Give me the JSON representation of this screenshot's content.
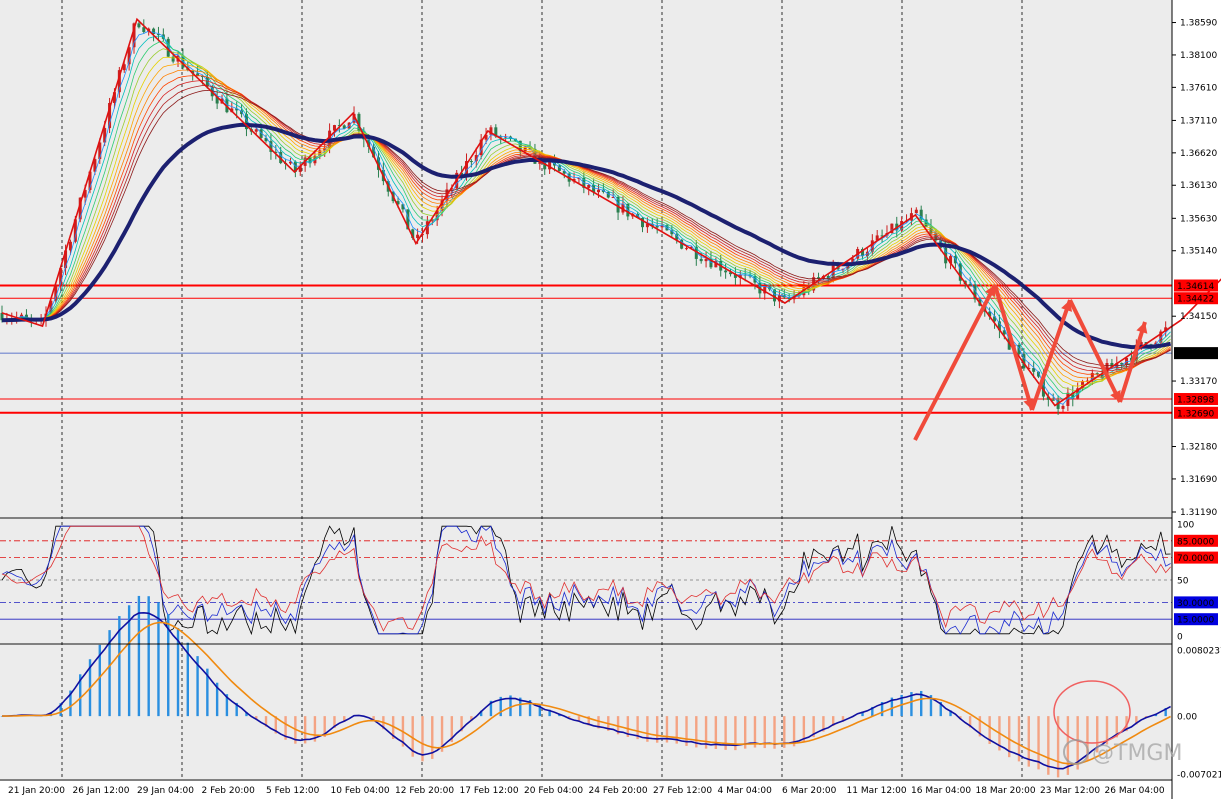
{
  "chart_data": {
    "type": "candlestick",
    "main_price_labels": [
      "1.38590",
      "1.38100",
      "1.37610",
      "1.37110",
      "1.36620",
      "1.36130",
      "1.35630",
      "1.35140",
      "1.34150",
      "1.33170",
      "1.32180",
      "1.31690",
      "1.31190"
    ],
    "price_range": [
      1.3119,
      1.3884
    ],
    "current_price": "1.33592",
    "horizontal_levels": [
      {
        "label": "1.34614",
        "value": 1.34614,
        "color": "#ff0000",
        "width": 2
      },
      {
        "label": "1.34422",
        "value": 1.34422,
        "color": "#ff0000",
        "width": 1
      },
      {
        "label": "1.32898",
        "value": 1.32898,
        "color": "#ff0000",
        "width": 1
      },
      {
        "label": "1.32690",
        "value": 1.3269,
        "color": "#ff0000",
        "width": 2
      }
    ],
    "time_labels": [
      "21 Jan 20:00",
      "26 Jan 12:00",
      "29 Jan 04:00",
      "2 Feb 20:00",
      "5 Feb 12:00",
      "10 Feb 04:00",
      "12 Feb 20:00",
      "17 Feb 12:00",
      "20 Feb 04:00",
      "24 Feb 20:00",
      "27 Feb 12:00",
      "4 Mar 04:00",
      "6 Mar 20:00",
      "11 Mar 12:00",
      "16 Mar 04:00",
      "18 Mar 20:00",
      "23 Mar 12:00",
      "26 Mar 04:00"
    ],
    "zigzag": [
      [
        0,
        1.342
      ],
      [
        0.9,
        1.34
      ],
      [
        3,
        1.3864
      ],
      [
        6.5,
        1.3633
      ],
      [
        7.8,
        1.3722
      ],
      [
        9.2,
        1.3525
      ],
      [
        10.8,
        1.3695
      ],
      [
        17.4,
        1.3435
      ],
      [
        20.3,
        1.3568
      ],
      [
        23.4,
        1.328
      ],
      [
        26.2,
        1.3409
      ],
      [
        27.2,
        1.3478
      ],
      [
        30.3,
        1.322
      ],
      [
        33.2,
        1.346
      ]
    ],
    "oscillator": {
      "labels": [
        "100",
        "85.0000",
        "70.0000",
        "50",
        "30.0000",
        "15.0000",
        "0"
      ],
      "levels": [
        85,
        70,
        50,
        30,
        15
      ]
    },
    "macd": {
      "labels": [
        "0.0080237",
        "0.00",
        "-0.007021"
      ],
      "range": [
        -0.007021,
        0.0080237
      ]
    },
    "watermark": "@TMGM"
  }
}
